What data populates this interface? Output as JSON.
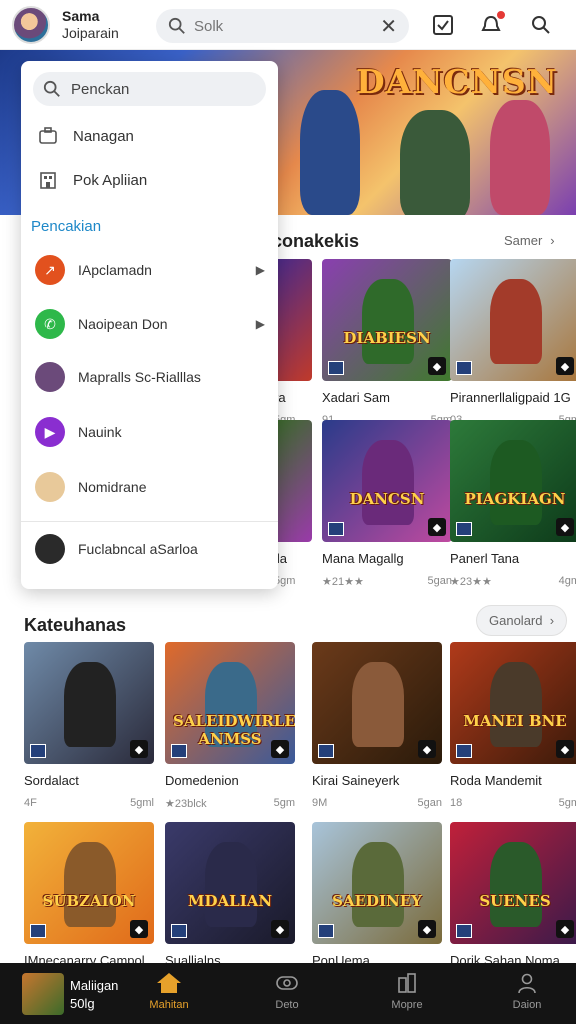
{
  "header": {
    "user_name": "Sama",
    "user_sub": "Joiparain",
    "search_placeholder": "Solk"
  },
  "banner": {
    "title": "DANCNSN"
  },
  "section_one": {
    "title": "conakekis",
    "see_more": "Samer",
    "cards": [
      {
        "title": "Xadari Sam",
        "meta_left": "91",
        "meta_right": "5gm",
        "logo": "DIABIESN",
        "bg": [
          "#8a3fb0",
          "#3f7a2c"
        ],
        "fig": "#2f6a2a"
      },
      {
        "title": "Pirannerllaligpaid 1G",
        "meta_left": "03",
        "meta_right": "5gm",
        "logo": "",
        "bg": [
          "#b6d6f0",
          "#a8753a"
        ],
        "fig": "#a33b2a"
      },
      {
        "title": "Mana Magallg",
        "meta_left": "★21★★",
        "meta_right": "5gan",
        "logo": "DANCSN",
        "bg": [
          "#2a3b8a",
          "#c04aa0"
        ],
        "fig": "#6a2a7a"
      },
      {
        "title": "Panerl Tana",
        "meta_left": "★23★★",
        "meta_right": "4gm",
        "logo": "PIAGKIAGN",
        "bg": [
          "#2d7a3a",
          "#0d3a1a"
        ],
        "fig": "#1d5a22"
      }
    ],
    "partial_left_titles": [
      "ra",
      "ila"
    ],
    "partial_left_meta": [
      "5gm",
      "5gm"
    ]
  },
  "section_two": {
    "title": "Kateuhanas",
    "see_more": "Ganolard",
    "cards": [
      {
        "title": "Sordalact",
        "meta_left": "4F",
        "meta_right": "5gml",
        "logo": "",
        "bg": [
          "#6f8aa8",
          "#2a2a3a"
        ],
        "fig": "#222"
      },
      {
        "title": "Domedenion",
        "meta_left": "★23blck",
        "meta_right": "5gm",
        "logo": "SALEIDWIRLE ANMSS",
        "bg": [
          "#e06a2a",
          "#3a5a9a"
        ],
        "fig": "#3a6a8a"
      },
      {
        "title": "Kirai Saineyerk",
        "meta_left": "9M",
        "meta_right": "5gan",
        "logo": "",
        "bg": [
          "#6b3a1a",
          "#2a1a0a"
        ],
        "fig": "#8a5a3a"
      },
      {
        "title": "Roda Mandemit",
        "meta_left": "18",
        "meta_right": "5gm",
        "logo": "MANEI BNE",
        "bg": [
          "#b03a1a",
          "#3a1a0a"
        ],
        "fig": "#4a3a2a"
      },
      {
        "title": "IMnecanarry Campol",
        "meta_left": "",
        "meta_right": "",
        "logo": "SUBZAION",
        "bg": [
          "#f2b23a",
          "#e06a1a"
        ],
        "fig": "#8a5a2a"
      },
      {
        "title": "Suallialns",
        "meta_left": "",
        "meta_right": "",
        "logo": "MDALIAN",
        "bg": [
          "#3a3a6a",
          "#1a1a2a"
        ],
        "fig": "#2a2a4a"
      },
      {
        "title": "PonUema",
        "meta_left": "",
        "meta_right": "",
        "logo": "SAEDINEY",
        "bg": [
          "#a8c4da",
          "#7a6a3a"
        ],
        "fig": "#5a6a3a"
      },
      {
        "title": "Dorik Sahan Noma",
        "meta_left": "",
        "meta_right": "",
        "logo": "SUENES",
        "bg": [
          "#c0203a",
          "#3a1a4a"
        ],
        "fig": "#2a5a2a"
      }
    ]
  },
  "panel": {
    "search_text": "Penckan",
    "items": [
      "Nanagan",
      "Pok Apliian"
    ],
    "heading": "Pencakian",
    "apps": [
      {
        "label": "IApclamadn",
        "color": "#e2511e",
        "glyph": "↗",
        "arrow": true
      },
      {
        "label": "Naoipean Don",
        "color": "#2eb84a",
        "glyph": "✆",
        "arrow": true
      },
      {
        "label": "Mapralls Sc-Rialllas",
        "color": "#6b4a7a",
        "glyph": "",
        "arrow": false
      },
      {
        "label": "Nauink",
        "color": "#8a2ed0",
        "glyph": "▶",
        "arrow": false
      },
      {
        "label": "Nomidrane",
        "color": "#e8c99a",
        "glyph": "",
        "arrow": false
      },
      {
        "label": "Fuclabncal aSarloa",
        "color": "#2a2a2a",
        "glyph": "",
        "arrow": false
      }
    ]
  },
  "bottom_nav": {
    "now_title": "Maliigan",
    "now_sub": "50lg",
    "items": [
      "Mahitan",
      "Deto",
      "Mopre",
      "Daion"
    ]
  }
}
